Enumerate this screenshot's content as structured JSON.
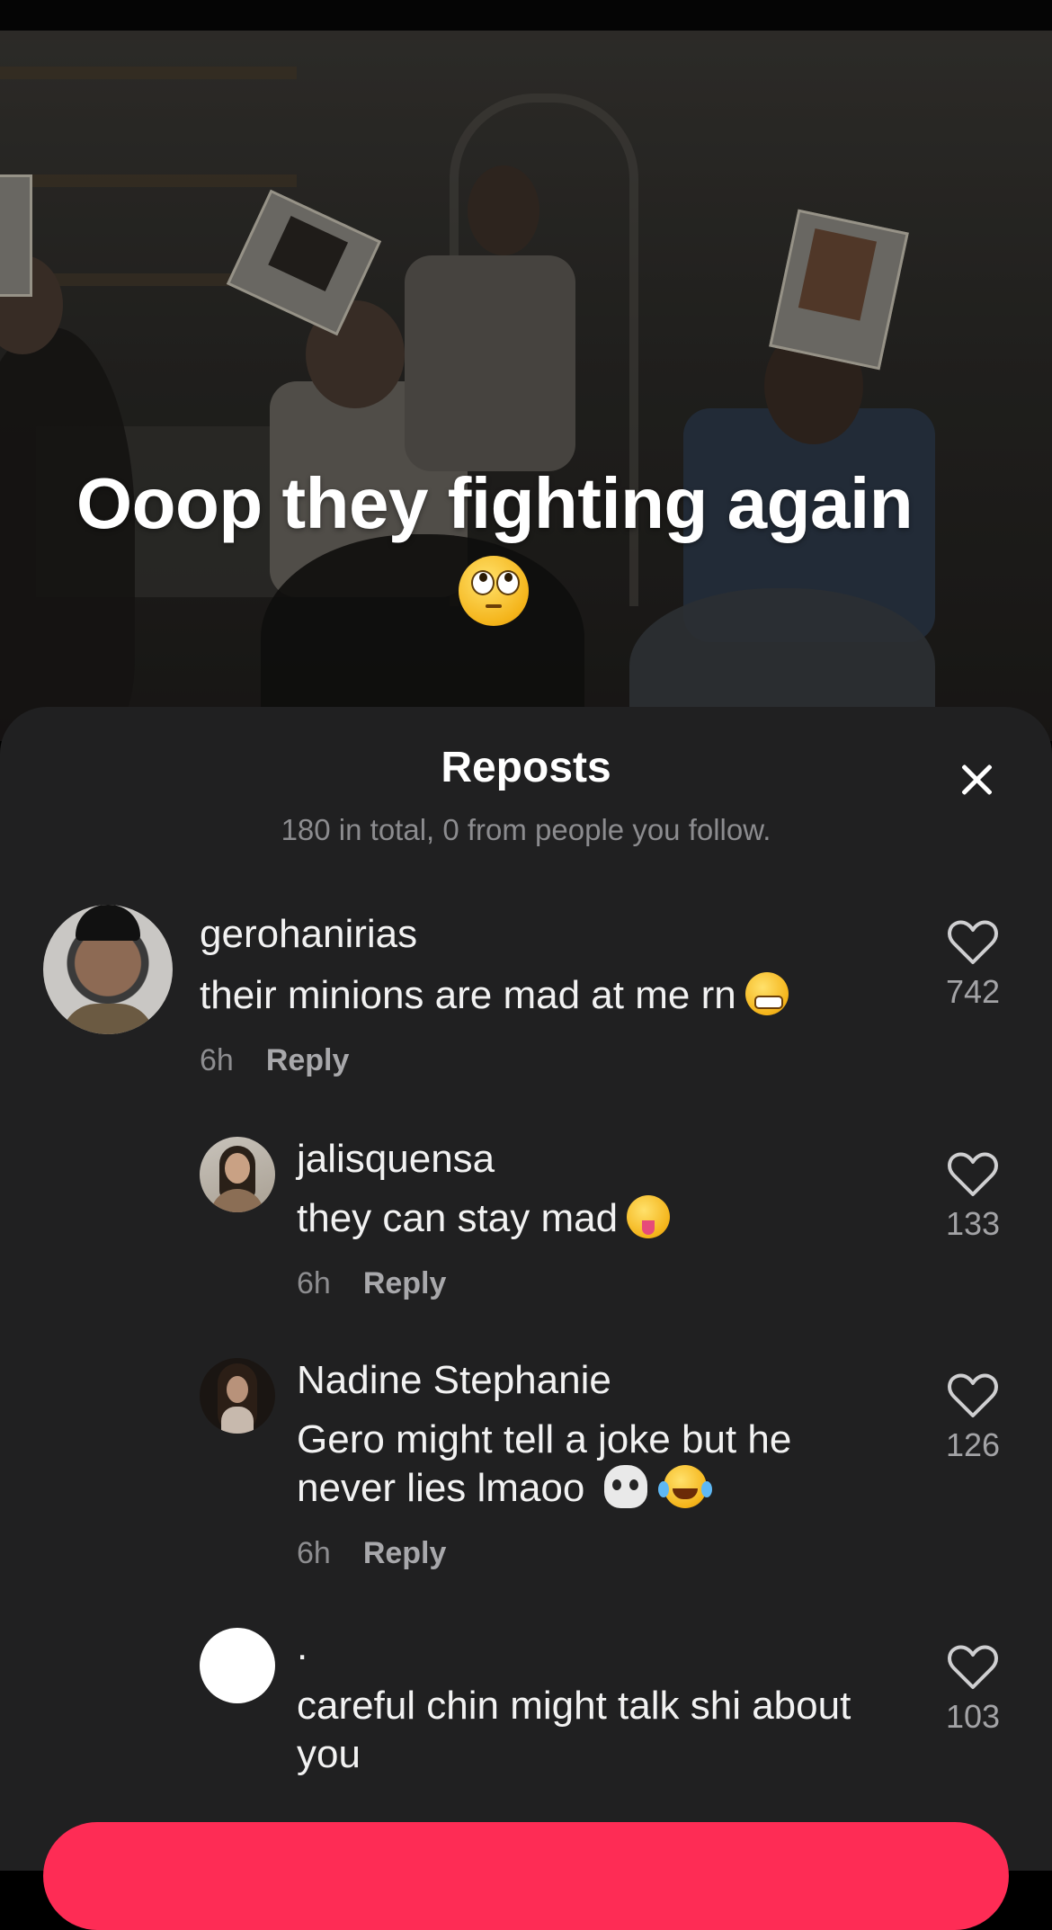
{
  "video": {
    "caption": "Ooop they fighting again",
    "caption_emoji": "face-with-rolling-eyes"
  },
  "sheet": {
    "title": "Reposts",
    "subtitle": "180 in total, 0 from people you follow.",
    "close_icon": "close-icon"
  },
  "comments": [
    {
      "username": "gerohanirias",
      "text": "their minions are mad at me rn",
      "emoji": "grimacing-face",
      "time": "6h",
      "reply_label": "Reply",
      "likes": "742"
    },
    {
      "username": "jalisquensa",
      "text": "they can stay mad",
      "emoji": "squinting-face-with-tongue",
      "time": "6h",
      "reply_label": "Reply",
      "likes": "133"
    },
    {
      "username": "Nadine Stephanie",
      "text_line1": "Gero might tell a joke but he",
      "text_line2": "never lies lmaoo",
      "emoji": [
        "skull",
        "face-with-tears-of-joy"
      ],
      "time": "6h",
      "reply_label": "Reply",
      "likes": "126"
    },
    {
      "username": ".",
      "text_line1": "careful chin might talk shi about",
      "text_line2": "you",
      "likes": "103"
    }
  ],
  "colors": {
    "sheet_bg": "#202021",
    "accent": "#fe2c55",
    "muted_text": "#8c8c8f"
  }
}
